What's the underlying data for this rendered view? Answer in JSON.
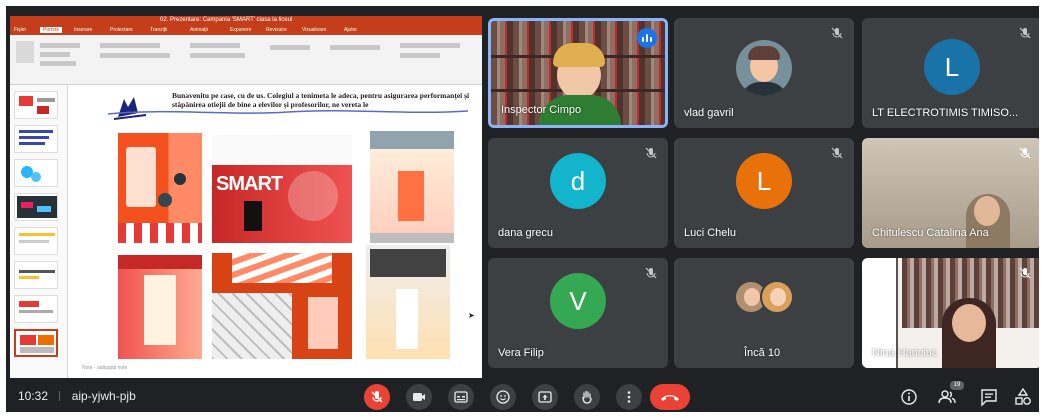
{
  "presentation": {
    "window_title": "02. Prezentare: Campania 'SMART' clasa la liceul",
    "ribbon_tabs": [
      "Fișier",
      "Pornire",
      "Inserare",
      "Proiectare",
      "Tranziții",
      "Animații",
      "Expunere",
      "Revizuire",
      "Vizualizare",
      "Ajutor"
    ],
    "slide_text": "Bunavenitu pe case, cu de us. Colegiul a tenimeta le adeca, pentru asigurarea performanței și stăpânirea otiejii de bine a elevilor și profesorilor, ne vereta le",
    "slide_logo": "SMART",
    "footer": "Note  ·  adăugați note"
  },
  "participants": [
    {
      "id": "t1",
      "name": "Inspector Cimpo",
      "type": "video",
      "speaking": true
    },
    {
      "id": "t2",
      "name": "vlad gavril",
      "type": "photo",
      "muted": true
    },
    {
      "id": "t3",
      "name": "LT ELECTROTIMIS TIMISO...",
      "type": "initial",
      "initial": "L",
      "color": "#1a73a8",
      "muted": true
    },
    {
      "id": "t4",
      "name": "dana grecu",
      "type": "initial",
      "initial": "d",
      "color": "#12b5cb",
      "muted": true
    },
    {
      "id": "t5",
      "name": "Luci Chelu",
      "type": "initial",
      "initial": "L",
      "color": "#e8710a",
      "muted": true
    },
    {
      "id": "t6",
      "name": "Chitulescu Catalina Ana",
      "type": "video",
      "muted": true
    },
    {
      "id": "t7",
      "name": "Vera Filip",
      "type": "initial",
      "initial": "V",
      "color": "#34a853",
      "muted": true
    },
    {
      "id": "t8",
      "name": "Încă 10",
      "type": "more"
    },
    {
      "id": "t9",
      "name": "Nina Hanciuc",
      "type": "video",
      "muted": true
    }
  ],
  "bottom_bar": {
    "time": "10:32",
    "meeting_code": "aip-yjwh-pjb",
    "participant_count": "19"
  },
  "colors": {
    "background": "#202124",
    "tile": "#3c4043",
    "danger": "#ea4335",
    "accent": "#8ab4f8",
    "powerpoint": "#c43e1c"
  }
}
